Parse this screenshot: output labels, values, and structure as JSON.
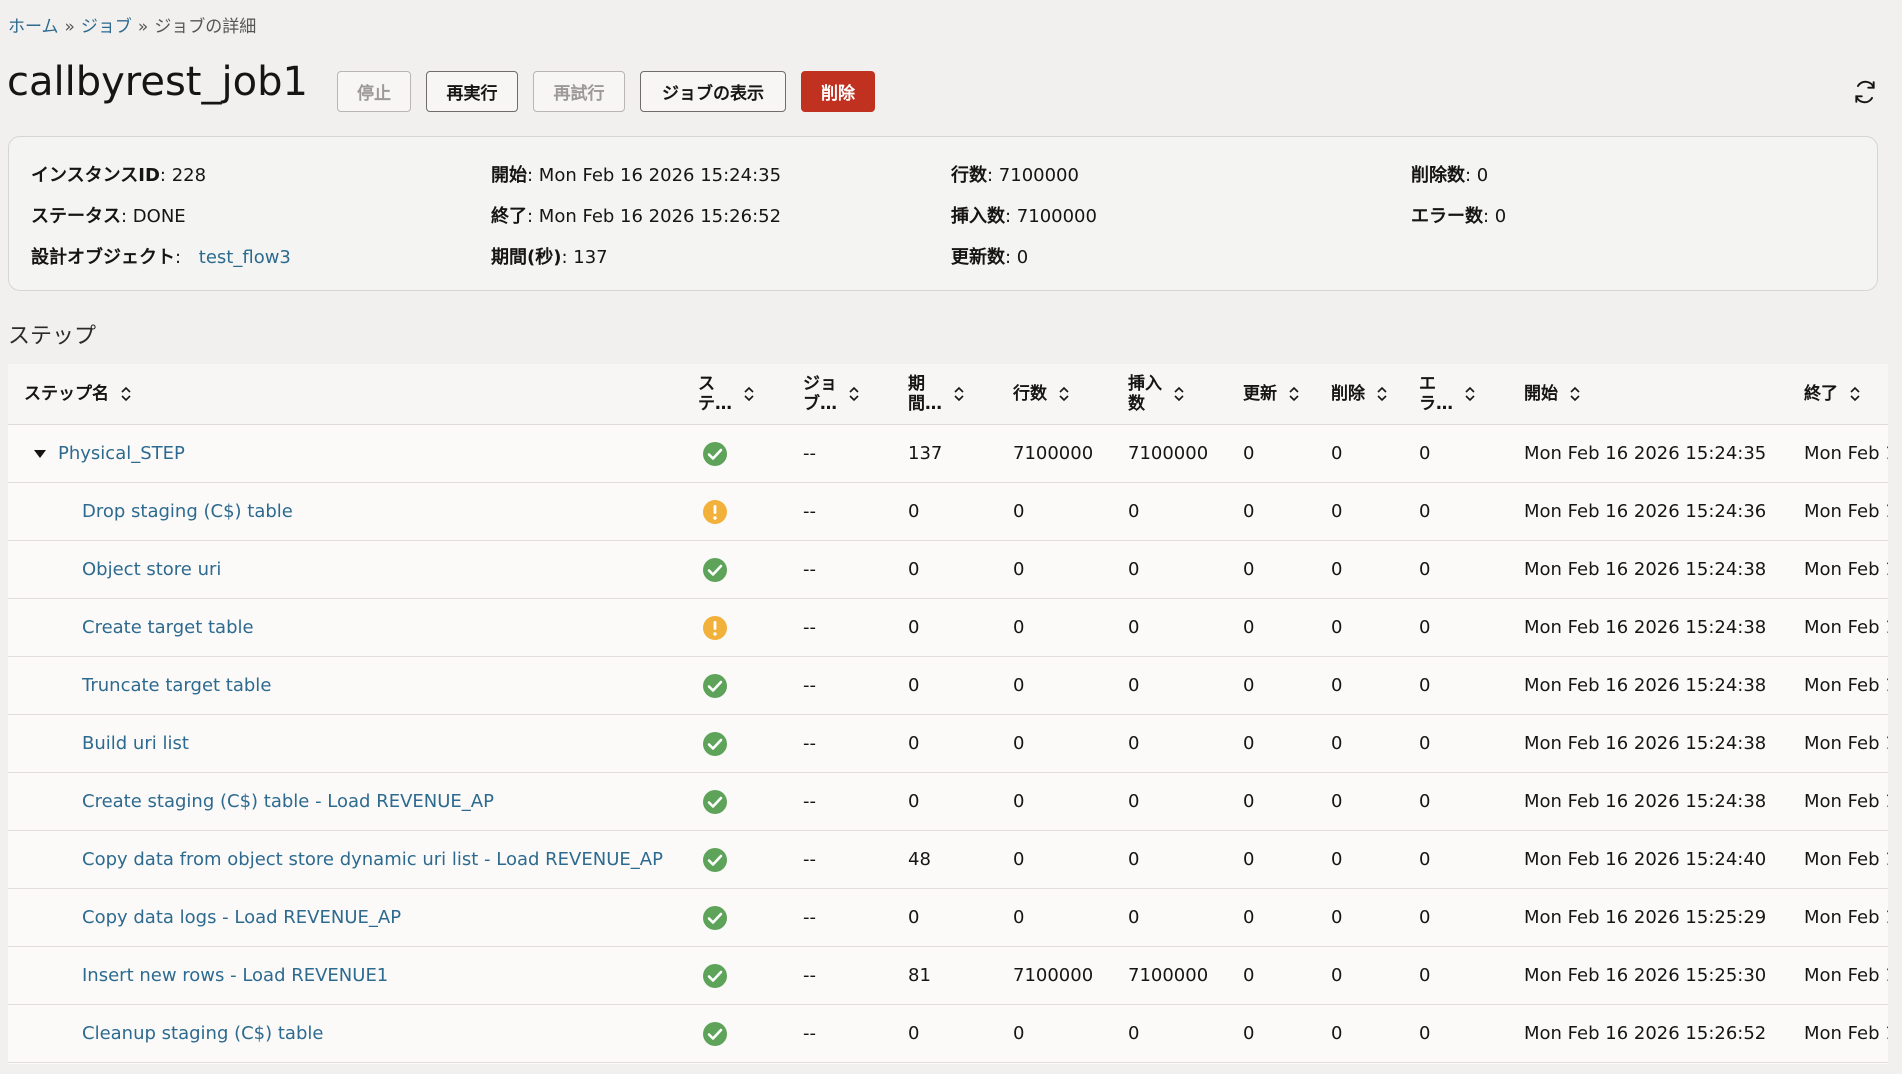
{
  "breadcrumb": {
    "home": "ホーム",
    "sep1": "»",
    "jobs": "ジョブ",
    "sep2": "»",
    "current": "ジョブの詳細"
  },
  "title": "callbyrest_job1",
  "toolbar": {
    "stop": "停止",
    "rerun": "再実行",
    "retry": "再試行",
    "show_job": "ジョブの表示",
    "delete": "削除"
  },
  "colors": {
    "link": "#2d6a8f",
    "danger": "#c0311f",
    "success": "#5ea35a",
    "warning": "#f2b13a"
  },
  "summary": {
    "instance_id_label": "インスタンスID",
    "instance_id": "228",
    "status_label": "ステータス",
    "status": "DONE",
    "design_object_label": "設計オブジェクト",
    "design_object": "test_flow3",
    "start_label": "開始",
    "start": "Mon Feb 16 2026 15:24:35",
    "end_label": "終了",
    "end": "Mon Feb 16 2026 15:26:52",
    "duration_label": "期間(秒)",
    "duration": "137",
    "rows_label": "行数",
    "rows": "7100000",
    "inserts_label": "挿入数",
    "inserts": "7100000",
    "updates_label": "更新数",
    "updates": "0",
    "deletes_label": "削除数",
    "deletes": "0",
    "errors_label": "エラー数",
    "errors": "0"
  },
  "steps_title": "ステップ",
  "columns": [
    "ステップ名",
    "ステ…",
    "ジョブ…",
    "期間…",
    "行数",
    "挿入数",
    "更新",
    "削除",
    "エラ…",
    "開始",
    "終了"
  ],
  "steps": [
    {
      "name": "Physical_STEP",
      "status": "success",
      "job": "--",
      "duration": "137",
      "rows": "7100000",
      "inserts": "7100000",
      "updates": "0",
      "deletes": "0",
      "errors": "0",
      "start": "Mon Feb 16 2026 15:24:35",
      "end": "Mon Feb 1"
    },
    {
      "name": "Drop staging (C$) table",
      "status": "warning",
      "job": "--",
      "duration": "0",
      "rows": "0",
      "inserts": "0",
      "updates": "0",
      "deletes": "0",
      "errors": "0",
      "start": "Mon Feb 16 2026 15:24:36",
      "end": "Mon Feb 1"
    },
    {
      "name": "Object store uri",
      "status": "success",
      "job": "--",
      "duration": "0",
      "rows": "0",
      "inserts": "0",
      "updates": "0",
      "deletes": "0",
      "errors": "0",
      "start": "Mon Feb 16 2026 15:24:38",
      "end": "Mon Feb 1"
    },
    {
      "name": "Create target table",
      "status": "warning",
      "job": "--",
      "duration": "0",
      "rows": "0",
      "inserts": "0",
      "updates": "0",
      "deletes": "0",
      "errors": "0",
      "start": "Mon Feb 16 2026 15:24:38",
      "end": "Mon Feb 1"
    },
    {
      "name": "Truncate target table",
      "status": "success",
      "job": "--",
      "duration": "0",
      "rows": "0",
      "inserts": "0",
      "updates": "0",
      "deletes": "0",
      "errors": "0",
      "start": "Mon Feb 16 2026 15:24:38",
      "end": "Mon Feb 1"
    },
    {
      "name": "Build uri list",
      "status": "success",
      "job": "--",
      "duration": "0",
      "rows": "0",
      "inserts": "0",
      "updates": "0",
      "deletes": "0",
      "errors": "0",
      "start": "Mon Feb 16 2026 15:24:38",
      "end": "Mon Feb 1"
    },
    {
      "name": "Create staging (C$) table - Load REVENUE_AP",
      "status": "success",
      "job": "--",
      "duration": "0",
      "rows": "0",
      "inserts": "0",
      "updates": "0",
      "deletes": "0",
      "errors": "0",
      "start": "Mon Feb 16 2026 15:24:38",
      "end": "Mon Feb 1"
    },
    {
      "name": "Copy data from object store dynamic uri list - Load REVENUE_AP",
      "status": "success",
      "job": "--",
      "duration": "48",
      "rows": "0",
      "inserts": "0",
      "updates": "0",
      "deletes": "0",
      "errors": "0",
      "start": "Mon Feb 16 2026 15:24:40",
      "end": "Mon Feb 1"
    },
    {
      "name": "Copy data logs - Load REVENUE_AP",
      "status": "success",
      "job": "--",
      "duration": "0",
      "rows": "0",
      "inserts": "0",
      "updates": "0",
      "deletes": "0",
      "errors": "0",
      "start": "Mon Feb 16 2026 15:25:29",
      "end": "Mon Feb 1"
    },
    {
      "name": "Insert new rows - Load REVENUE1",
      "status": "success",
      "job": "--",
      "duration": "81",
      "rows": "7100000",
      "inserts": "7100000",
      "updates": "0",
      "deletes": "0",
      "errors": "0",
      "start": "Mon Feb 16 2026 15:25:30",
      "end": "Mon Feb 1"
    },
    {
      "name": "Cleanup staging (C$) table",
      "status": "success",
      "job": "--",
      "duration": "0",
      "rows": "0",
      "inserts": "0",
      "updates": "0",
      "deletes": "0",
      "errors": "0",
      "start": "Mon Feb 16 2026 15:26:52",
      "end": "Mon Feb 1"
    }
  ]
}
